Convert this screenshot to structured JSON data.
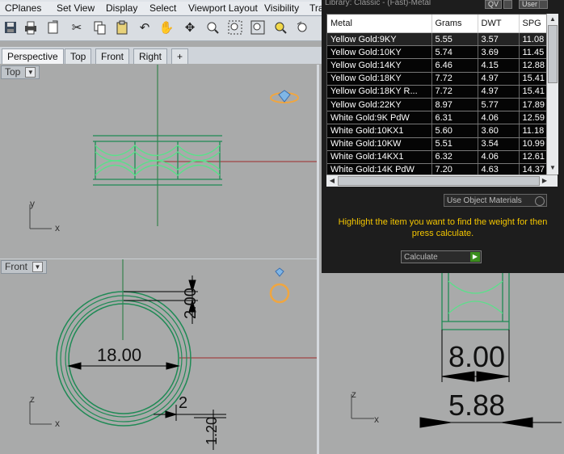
{
  "menu_tabs": [
    "CPlanes",
    "Set View",
    "Display",
    "Select",
    "Viewport Layout",
    "Visibility",
    "Tra"
  ],
  "toolbar_icons": [
    "save-icon",
    "print-icon",
    "import-icon",
    "cut-icon",
    "copy-icon",
    "paste-icon",
    "undo-icon",
    "pan-icon",
    "rotate-icon",
    "zoom-icon",
    "zoom-window-icon",
    "zoom-extents-icon",
    "zoom-selected-icon",
    "redo-view-icon"
  ],
  "viewport_tabs": [
    "Perspective",
    "Top",
    "Front",
    "Right",
    "+"
  ],
  "viewports": {
    "top": {
      "label": "Top"
    },
    "front": {
      "label": "Front"
    }
  },
  "axis_labels": {
    "x": "x",
    "y": "y",
    "z": "z"
  },
  "dimensions": {
    "front_diameter": "18.00",
    "front_height": "2.00",
    "front_thickness": "2",
    "front_small": "1.20",
    "right_width": "8.00",
    "right_inner": "5.88"
  },
  "panel": {
    "title": "Library: Classic - (Fast)-Metal",
    "btn_qv": "QV",
    "btn_user": "User",
    "columns": [
      "Metal",
      "Grams",
      "DWT",
      "SPG"
    ],
    "rows": [
      {
        "metal": "Yellow Gold:9KY",
        "grams": "5.55",
        "dwt": "3.57",
        "spg": "11.08"
      },
      {
        "metal": "Yellow Gold:10KY",
        "grams": "5.74",
        "dwt": "3.69",
        "spg": "11.45"
      },
      {
        "metal": "Yellow Gold:14KY",
        "grams": "6.46",
        "dwt": "4.15",
        "spg": "12.88"
      },
      {
        "metal": "Yellow Gold:18KY",
        "grams": "7.72",
        "dwt": "4.97",
        "spg": "15.41"
      },
      {
        "metal": "Yellow Gold:18KY R...",
        "grams": "7.72",
        "dwt": "4.97",
        "spg": "15.41"
      },
      {
        "metal": "Yellow Gold:22KY",
        "grams": "8.97",
        "dwt": "5.77",
        "spg": "17.89"
      },
      {
        "metal": "White Gold:9K PdW",
        "grams": "6.31",
        "dwt": "4.06",
        "spg": "12.59"
      },
      {
        "metal": "White Gold:10KX1",
        "grams": "5.60",
        "dwt": "3.60",
        "spg": "11.18"
      },
      {
        "metal": "White Gold:10KW",
        "grams": "5.51",
        "dwt": "3.54",
        "spg": "10.99"
      },
      {
        "metal": "White Gold:14KX1",
        "grams": "6.32",
        "dwt": "4.06",
        "spg": "12.61"
      },
      {
        "metal": "White Gold:14K PdW",
        "grams": "7.20",
        "dwt": "4.63",
        "spg": "14.37"
      }
    ],
    "use_object_materials": "Use Object Materials",
    "instruction": "Highlight the item you want to find the weight for then press calculate.",
    "calculate": "Calculate"
  },
  "colors": {
    "viewport_bg": "#a9aaaa",
    "ring_green": "#1f8a55",
    "ring_light_green": "#5be08a",
    "axis_red": "#9e2a2a",
    "axis_green": "#1e7a3a",
    "instruction_yellow": "#f4c600",
    "preview_orange": "#f0a640"
  }
}
